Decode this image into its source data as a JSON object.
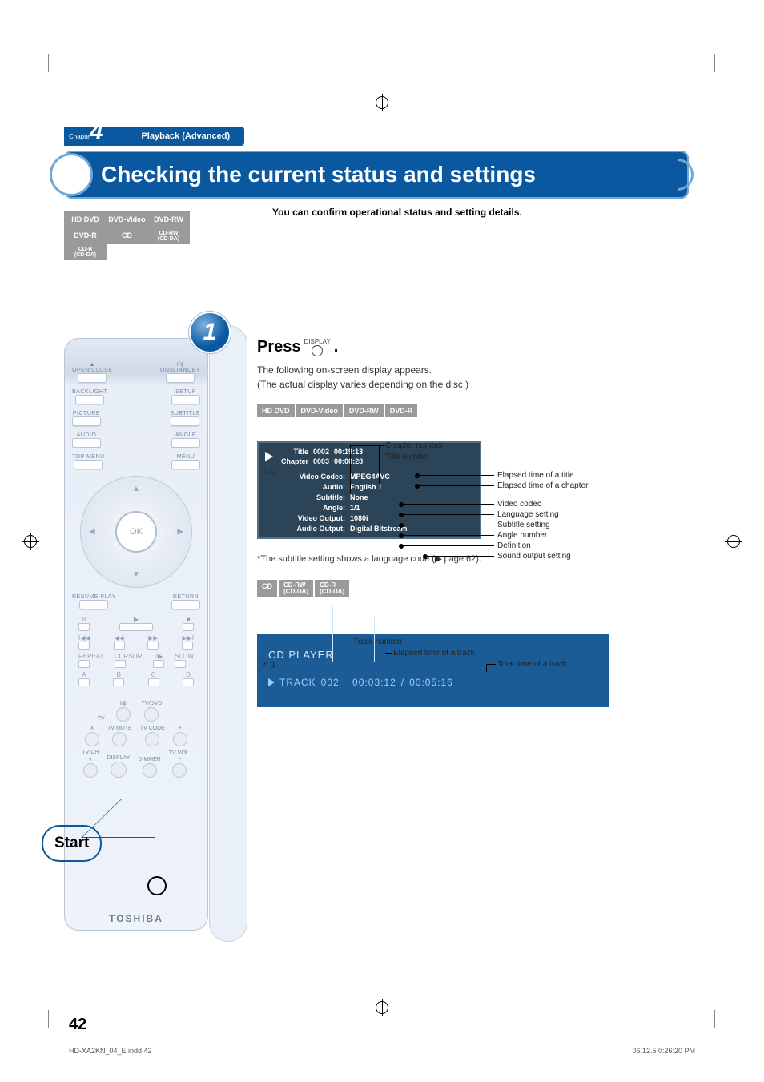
{
  "chapter": {
    "label": "Chapter",
    "number": "4",
    "title": "Playback (Advanced)"
  },
  "banner": "Checking the current status and settings",
  "intro": "You can confirm operational status and setting details.",
  "badges": {
    "r1c1": "HD DVD",
    "r1c2": "DVD-Video",
    "r1c3": "DVD-RW",
    "r2c1": "DVD-R",
    "r2c2": "CD",
    "r2c3": "CD-RW\n(CD-DA)",
    "r3c1": "CD-R\n(CD-DA)"
  },
  "remote": {
    "open_close": "OPEN/CLOSE",
    "on_standby": "ON/STANDBY",
    "backlight": "BACKLIGHT",
    "setup": "SETUP",
    "picture": "PICTURE",
    "subtitle": "SUBTITLE",
    "audio": "AUDIO",
    "angle": "ANGLE",
    "topmenu": "TOP MENU",
    "menu": "MENU",
    "ok": "OK",
    "resume": "RESUME PLAY",
    "return": "RETURN",
    "repeat": "REPEAT",
    "cursor": "CURSOR",
    "step": "II▶",
    "slow": "SLOW",
    "a": "A",
    "b": "B",
    "c": "C",
    "d": "D",
    "tv": "TV",
    "tvdvd": "TV/DVD",
    "tvmute": "TV MUTE",
    "tvcode": "TV CODE",
    "tvch": "TV CH",
    "tvvol": "TV VOL.",
    "display": "DISPLAY",
    "dimmer": "DIMMER",
    "iphi": "I/ϕ",
    "brand": "TOSHIBA",
    "start": "Start"
  },
  "step": {
    "number": "1",
    "press": "Press",
    "display_icon_label": "DISPLAY",
    "period": ".",
    "line1": "The following on-screen display appears.",
    "line2": "(The actual display varies depending on the disc.)"
  },
  "osd_tabs_top": {
    "t1": "HD DVD",
    "t2": "DVD-Video",
    "t3": "DVD-RW",
    "t4": "DVD-R"
  },
  "osd_top_labels": {
    "chapter_number": "Chapter number",
    "title_number": "Title number",
    "eg": "e.g."
  },
  "osd_top": {
    "title_k": "Title",
    "title_v": "0002",
    "title_t": "00:19:13",
    "chapter_k": "Chapter",
    "chapter_v": "0003",
    "chapter_t": "00:00:28",
    "vcodec_k": "Video Codec:",
    "vcodec_v": "MPEG4AVC",
    "audio_k": "Audio:",
    "audio_v": "English 1",
    "subtitle_k": "Subtitle:",
    "subtitle_v": "None",
    "angle_k": "Angle:",
    "angle_v": "1/1",
    "vout_k": "Video Output:",
    "vout_v": "1080i",
    "aout_k": "Audio Output:",
    "aout_v": "Digital Bitstream"
  },
  "callouts_top": {
    "elapsed_title": "Elapsed time of a title",
    "elapsed_chapter": "Elapsed time of a chapter",
    "video_codec": "Video codec",
    "lang": "Language setting",
    "subtitle": "Subtitle setting",
    "angle": "Angle number",
    "definition": "Definition",
    "sound": "Sound output setting"
  },
  "sub_note_prefix": "*The subtitle setting shows a language code (",
  "sub_note_page": " page 62).",
  "osd_tabs_cd": {
    "t1": "CD",
    "t2": "CD-RW\n(CD-DA)",
    "t3": "CD-R\n(CD-DA)"
  },
  "cd_labels": {
    "track_number": "Track number",
    "elapsed": "Elapsed time of a track",
    "total": "Total time of a track",
    "eg": "e.g."
  },
  "cd_osd": {
    "title": "CD PLAYER",
    "track_label": "TRACK",
    "track_num": "002",
    "elapsed": "00:03:12",
    "sep": "/",
    "total": "00:05:16"
  },
  "page_number": "42",
  "footer_left": "HD-XA2KN_04_E.indd   42",
  "footer_right": "06.12.5   0:26:20 PM"
}
